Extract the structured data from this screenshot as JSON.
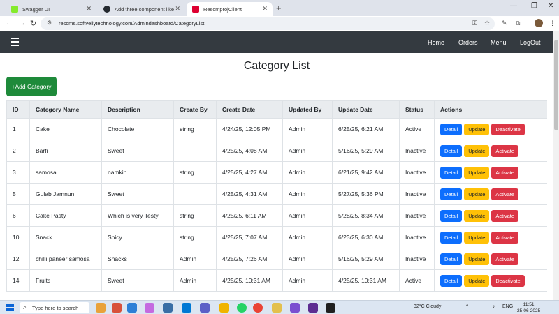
{
  "browser": {
    "tabs": [
      {
        "title": "Swagger UI",
        "favicon_color": "#85ea2d"
      },
      {
        "title": "Add three component like list ...",
        "favicon_color": "#24292f"
      },
      {
        "title": "RescmprojClient",
        "favicon_color": "#dd0031"
      }
    ],
    "new_tab_glyph": "+",
    "url": "rescms.softvellytechnology.com/Admindashboard/CategoryList"
  },
  "navbar": {
    "links": [
      "Home",
      "Orders",
      "Menu",
      "LogOut"
    ]
  },
  "page": {
    "title": "Category List",
    "add_button": "+Add Category"
  },
  "table": {
    "columns": [
      "ID",
      "Category Name",
      "Description",
      "Create By",
      "Create Date",
      "Updated By",
      "Update Date",
      "Status",
      "Actions"
    ],
    "rows": [
      {
        "id": "1",
        "name": "Cake",
        "description": "Chocolate",
        "create_by": "string",
        "create_date": "4/24/25, 12:05 PM",
        "updated_by": "Admin",
        "update_date": "6/25/25, 6:21 AM",
        "status": "Active",
        "actions": [
          "Detail",
          "Update",
          "Deactivate"
        ]
      },
      {
        "id": "2",
        "name": "Barfi",
        "description": "Sweet",
        "create_by": "",
        "create_date": "4/25/25, 4:08 AM",
        "updated_by": "Admin",
        "update_date": "5/16/25, 5:29 AM",
        "status": "Inactive",
        "actions": [
          "Detail",
          "Update",
          "Activate"
        ]
      },
      {
        "id": "3",
        "name": "samosa",
        "description": "namkin",
        "create_by": "string",
        "create_date": "4/25/25, 4:27 AM",
        "updated_by": "Admin",
        "update_date": "6/21/25, 9:42 AM",
        "status": "Inactive",
        "actions": [
          "Detail",
          "Update",
          "Activate"
        ]
      },
      {
        "id": "5",
        "name": "Gulab Jamnun",
        "description": "Sweet",
        "create_by": "",
        "create_date": "4/25/25, 4:31 AM",
        "updated_by": "Admin",
        "update_date": "5/27/25, 5:36 PM",
        "status": "Inactive",
        "actions": [
          "Detail",
          "Update",
          "Activate"
        ]
      },
      {
        "id": "6",
        "name": "Cake Pasty",
        "description": "Which is very Testy",
        "create_by": "string",
        "create_date": "4/25/25, 6:11 AM",
        "updated_by": "Admin",
        "update_date": "5/28/25, 8:34 AM",
        "status": "Inactive",
        "actions": [
          "Detail",
          "Update",
          "Activate"
        ]
      },
      {
        "id": "10",
        "name": "Snack",
        "description": "Spicy",
        "create_by": "string",
        "create_date": "4/25/25, 7:07 AM",
        "updated_by": "Admin",
        "update_date": "6/23/25, 6:30 AM",
        "status": "Inactive",
        "actions": [
          "Detail",
          "Update",
          "Activate"
        ]
      },
      {
        "id": "12",
        "name": "chilli paneer samosa",
        "description": "Snacks",
        "create_by": "Admin",
        "create_date": "4/25/25, 7:26 AM",
        "updated_by": "Admin",
        "update_date": "5/16/25, 5:29 AM",
        "status": "Inactive",
        "actions": [
          "Detail",
          "Update",
          "Activate"
        ]
      },
      {
        "id": "14",
        "name": "Fruits",
        "description": "Sweet",
        "create_by": "Admin",
        "create_date": "4/25/25, 10:31 AM",
        "updated_by": "Admin",
        "update_date": "4/25/25, 10:31 AM",
        "status": "Active",
        "actions": [
          "Detail",
          "Update",
          "Deactivate"
        ]
      }
    ]
  },
  "taskbar": {
    "search_placeholder": "Type here to search",
    "weather": "32°C  Cloudy",
    "language": "ENG",
    "time": "11:51",
    "date": "25-06-2025"
  },
  "colors": {
    "navbar": "#343a40",
    "add_button": "#1e8a3a",
    "detail": "#0d6efd",
    "update": "#ffc107",
    "danger": "#dc3545"
  }
}
